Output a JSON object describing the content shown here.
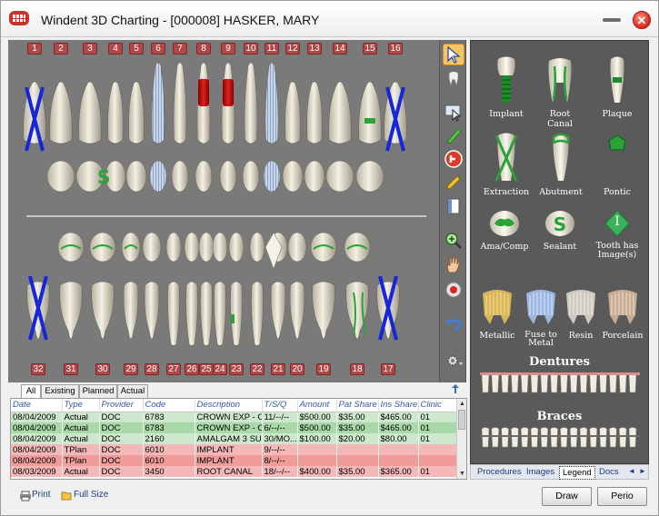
{
  "window": {
    "title": "Windent 3D Charting - [000008] HASKER, MARY",
    "close_glyph": "✕"
  },
  "upper_numbers": [
    "1",
    "2",
    "3",
    "4",
    "5",
    "6",
    "7",
    "8",
    "9",
    "10",
    "11",
    "12",
    "13",
    "14",
    "15",
    "16"
  ],
  "lower_numbers": [
    "32",
    "31",
    "30",
    "29",
    "28",
    "27",
    "26",
    "25",
    "24",
    "23",
    "22",
    "21",
    "20",
    "19",
    "18",
    "17"
  ],
  "lower_anterior_notation": "S",
  "toolbar_icons": [
    "arrow-select-icon",
    "tooth-select-icon",
    "pointer-icon",
    "drill-icon",
    "no-entry-icon",
    "pencil-icon",
    "page-icon",
    "zoom-icon",
    "hand-icon",
    "target-icon",
    "undo-icon",
    "settings-icon"
  ],
  "legend": {
    "items": [
      {
        "label": "Implant"
      },
      {
        "label": "Root Canal"
      },
      {
        "label": "Plaque"
      },
      {
        "label": "Extraction"
      },
      {
        "label": "Abutment"
      },
      {
        "label": "Pontic"
      },
      {
        "label": "Ama/Comp"
      },
      {
        "label": "Sealant"
      },
      {
        "label": "Tooth has Image(s)"
      },
      {
        "label": "Metallic"
      },
      {
        "label": "Fuse to Metal"
      },
      {
        "label": "Resin"
      },
      {
        "label": "Porcelain"
      }
    ],
    "sealant_glyph": "S",
    "image_glyph": "I",
    "dentures_title": "Dentures",
    "braces_title": "Braces",
    "tabs": [
      "Procedures",
      "Images",
      "Legend",
      "Docs"
    ],
    "active_tab": "Legend",
    "nav_left": "◄",
    "nav_right": "►"
  },
  "grid": {
    "tabs": [
      "All",
      "Existing",
      "Planned",
      "Actual"
    ],
    "active_tab": "All",
    "columns": [
      "Date",
      "Type",
      "Provider",
      "Code",
      "Description",
      "T/S/Q",
      "Amount",
      "Pat Share",
      "Ins Share",
      "Clinic"
    ],
    "rows": [
      {
        "kind": "actual",
        "cells": [
          "08/04/2009",
          "Actual",
          "DOC",
          "6783",
          "CROWN EXP - O...",
          "11/--/--",
          "$500.00",
          "$35.00",
          "$465.00",
          "01"
        ]
      },
      {
        "kind": "actual2",
        "cells": [
          "08/04/2009",
          "Actual",
          "DOC",
          "6783",
          "CROWN EXP - O...",
          "6/--/--",
          "$500.00",
          "$35.00",
          "$465.00",
          "01"
        ]
      },
      {
        "kind": "actual",
        "cells": [
          "08/04/2009",
          "Actual",
          "DOC",
          "2160",
          "AMALGAM 3 SU...",
          "30/MO...",
          "$100.00",
          "$20.00",
          "$80.00",
          "01"
        ]
      },
      {
        "kind": "tplan",
        "cells": [
          "08/04/2009",
          "TPlan",
          "DOC",
          "6010",
          "IMPLANT",
          "9/--/--",
          "",
          "",
          "",
          ""
        ]
      },
      {
        "kind": "tplan2",
        "cells": [
          "08/04/2009",
          "TPlan",
          "DOC",
          "6010",
          "IMPLANT",
          "8/--/--",
          "",
          "",
          "",
          ""
        ]
      },
      {
        "kind": "tplan",
        "cells": [
          "08/03/2009",
          "Actual",
          "DOC",
          "3450",
          "ROOT CANAL",
          "18/--/--",
          "$400.00",
          "$35.00",
          "$365.00",
          "01"
        ]
      }
    ],
    "scroll_up": "▲",
    "scroll_down": "▼"
  },
  "bottom": {
    "print_label": "Print",
    "fullsize_label": "Full Size",
    "draw_label": "Draw",
    "perio_label": "Perio"
  }
}
